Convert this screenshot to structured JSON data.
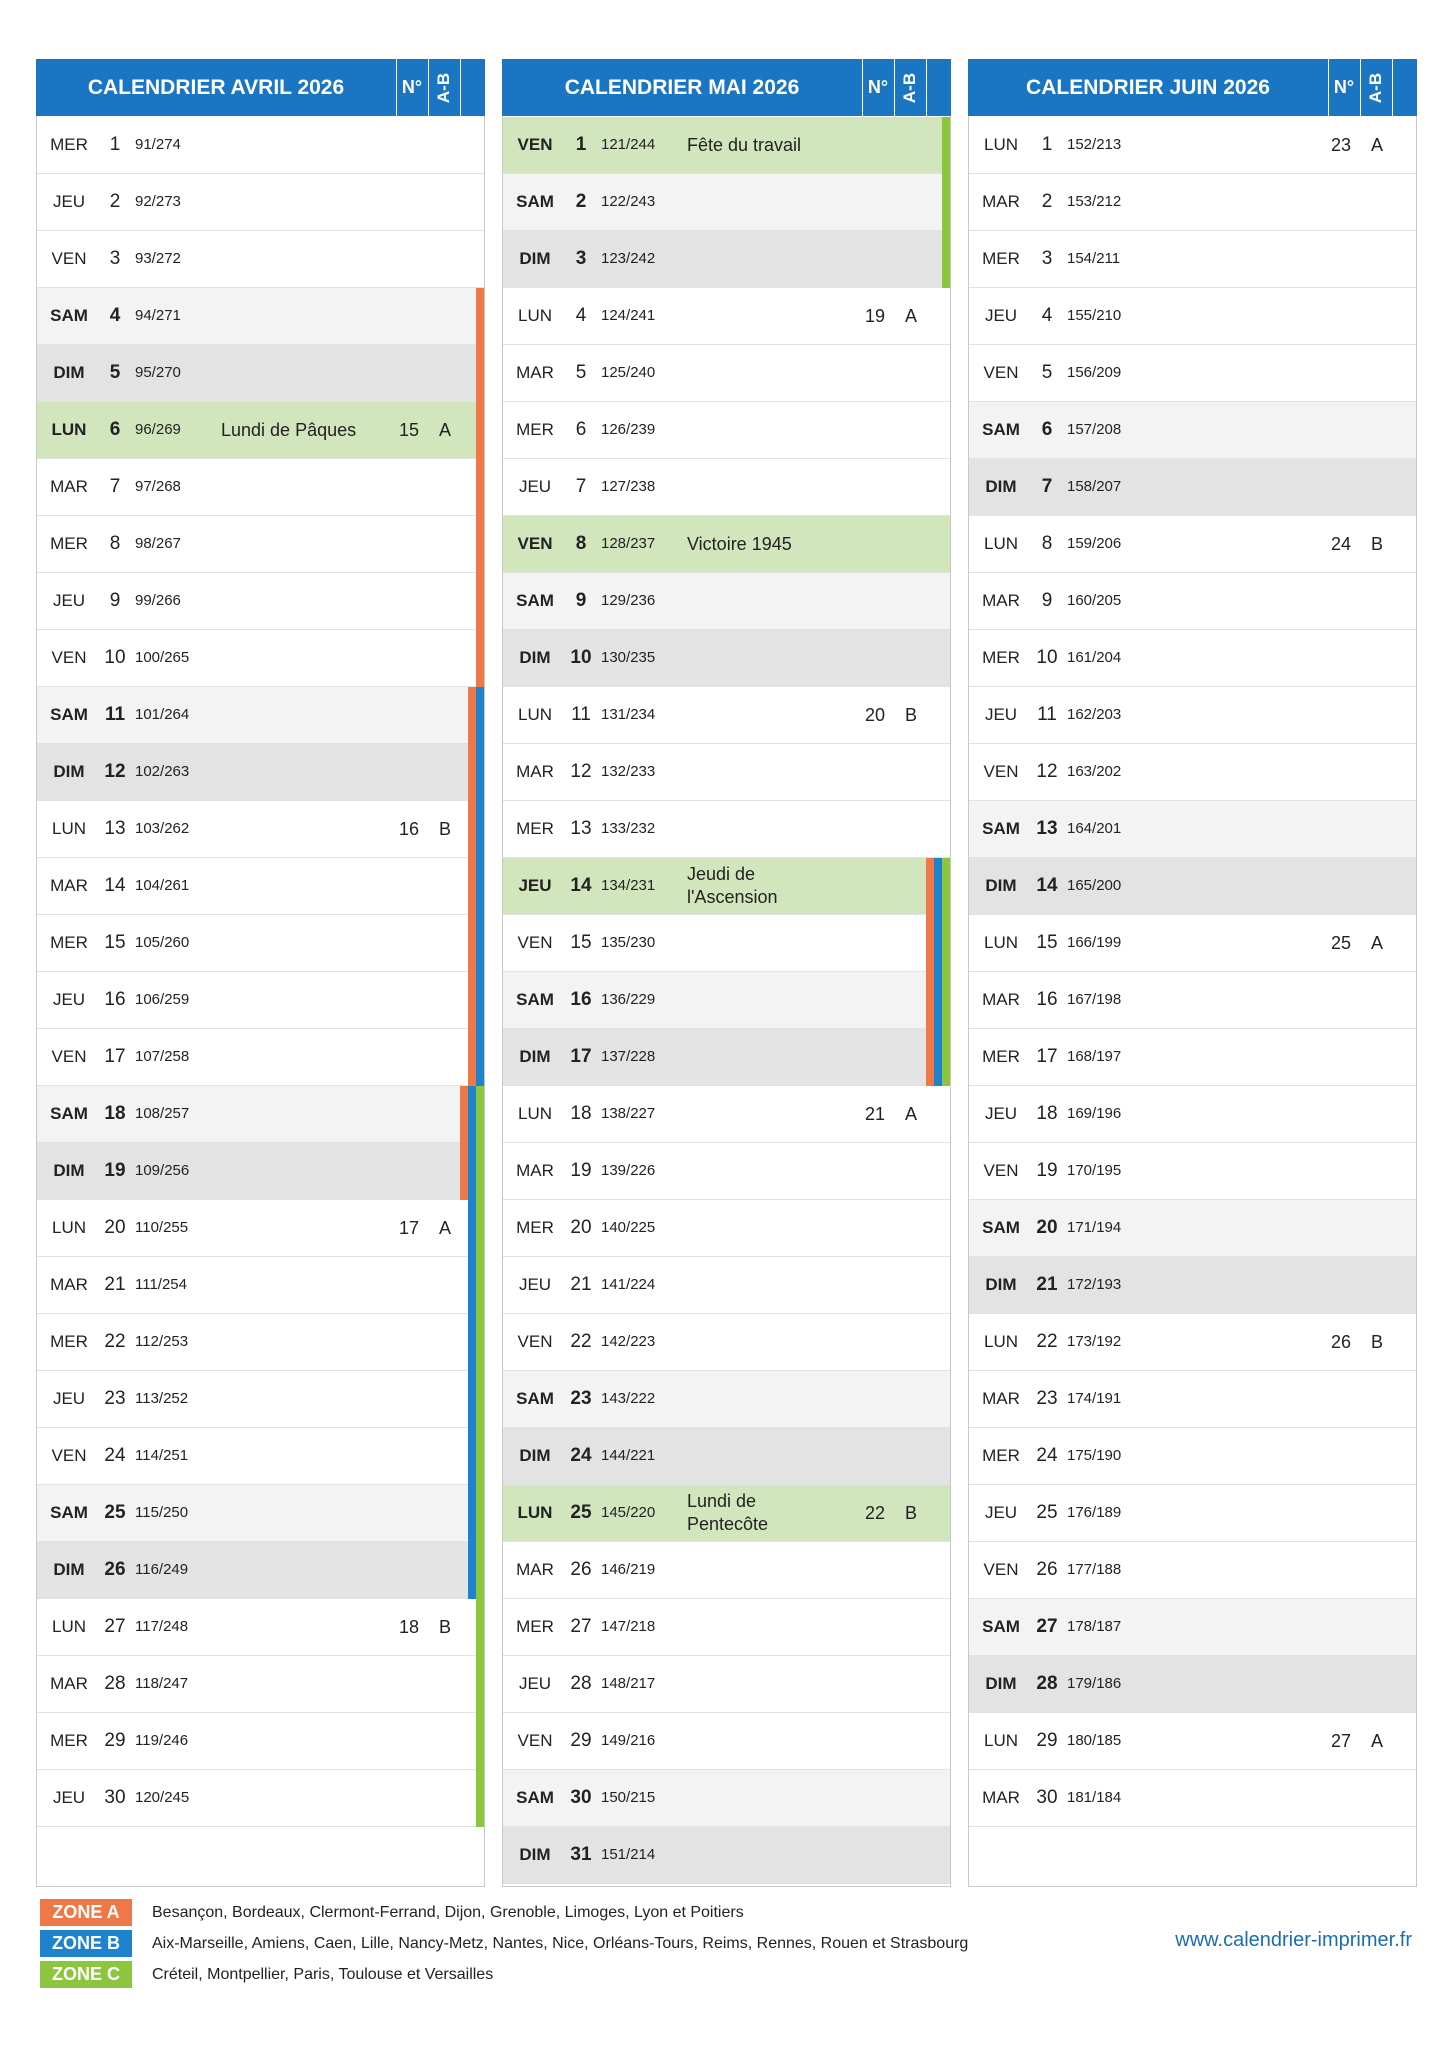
{
  "header_labels": {
    "no": "N°",
    "ab": "A-B"
  },
  "zones": [
    {
      "label": "ZONE A",
      "color": "#ee7848",
      "cities": "Besançon, Bordeaux, Clermont-Ferrand, Dijon, Grenoble, Limoges, Lyon et Poitiers"
    },
    {
      "label": "ZONE B",
      "color": "#1f82cc",
      "cities": "Aix-Marseille, Amiens, Caen, Lille, Nancy-Metz, Nantes, Nice, Orléans-Tours, Reims, Rennes, Rouen et Strasbourg"
    },
    {
      "label": "ZONE C",
      "color": "#8cc63e",
      "cities": "Créteil, Montpellier, Paris, Toulouse et Versailles"
    }
  ],
  "website": "www.calendrier-imprimer.fr",
  "months": [
    {
      "title": "CALENDRIER AVRIL 2026",
      "days": [
        {
          "d": "MER",
          "n": "1",
          "y": "91/274"
        },
        {
          "d": "JEU",
          "n": "2",
          "y": "92/273"
        },
        {
          "d": "VEN",
          "n": "3",
          "y": "93/272"
        },
        {
          "d": "SAM",
          "n": "4",
          "y": "94/271",
          "z": "A"
        },
        {
          "d": "DIM",
          "n": "5",
          "y": "95/270",
          "z": "A"
        },
        {
          "d": "LUN",
          "n": "6",
          "y": "96/269",
          "h": "Lundi de Pâques",
          "w": "15",
          "ab": "A",
          "z": "A"
        },
        {
          "d": "MAR",
          "n": "7",
          "y": "97/268",
          "z": "A"
        },
        {
          "d": "MER",
          "n": "8",
          "y": "98/267",
          "z": "A"
        },
        {
          "d": "JEU",
          "n": "9",
          "y": "99/266",
          "z": "A"
        },
        {
          "d": "VEN",
          "n": "10",
          "y": "100/265",
          "z": "A"
        },
        {
          "d": "SAM",
          "n": "11",
          "y": "101/264",
          "z": "AB"
        },
        {
          "d": "DIM",
          "n": "12",
          "y": "102/263",
          "z": "AB"
        },
        {
          "d": "LUN",
          "n": "13",
          "y": "103/262",
          "w": "16",
          "ab": "B",
          "z": "AB"
        },
        {
          "d": "MAR",
          "n": "14",
          "y": "104/261",
          "z": "AB"
        },
        {
          "d": "MER",
          "n": "15",
          "y": "105/260",
          "z": "AB"
        },
        {
          "d": "JEU",
          "n": "16",
          "y": "106/259",
          "z": "AB"
        },
        {
          "d": "VEN",
          "n": "17",
          "y": "107/258",
          "z": "AB"
        },
        {
          "d": "SAM",
          "n": "18",
          "y": "108/257",
          "z": "ABC"
        },
        {
          "d": "DIM",
          "n": "19",
          "y": "109/256",
          "z": "ABC"
        },
        {
          "d": "LUN",
          "n": "20",
          "y": "110/255",
          "w": "17",
          "ab": "A",
          "z": "BC"
        },
        {
          "d": "MAR",
          "n": "21",
          "y": "111/254",
          "z": "BC"
        },
        {
          "d": "MER",
          "n": "22",
          "y": "112/253",
          "z": "BC"
        },
        {
          "d": "JEU",
          "n": "23",
          "y": "113/252",
          "z": "BC"
        },
        {
          "d": "VEN",
          "n": "24",
          "y": "114/251",
          "z": "BC"
        },
        {
          "d": "SAM",
          "n": "25",
          "y": "115/250",
          "z": "BC"
        },
        {
          "d": "DIM",
          "n": "26",
          "y": "116/249",
          "z": "BC"
        },
        {
          "d": "LUN",
          "n": "27",
          "y": "117/248",
          "w": "18",
          "ab": "B",
          "z": "C"
        },
        {
          "d": "MAR",
          "n": "28",
          "y": "118/247",
          "z": "C"
        },
        {
          "d": "MER",
          "n": "29",
          "y": "119/246",
          "z": "C"
        },
        {
          "d": "JEU",
          "n": "30",
          "y": "120/245",
          "z": "C"
        }
      ]
    },
    {
      "title": "CALENDRIER MAI 2026",
      "days": [
        {
          "d": "VEN",
          "n": "1",
          "y": "121/244",
          "h": "Fête du travail",
          "z": "C"
        },
        {
          "d": "SAM",
          "n": "2",
          "y": "122/243",
          "z": "C"
        },
        {
          "d": "DIM",
          "n": "3",
          "y": "123/242",
          "z": "C"
        },
        {
          "d": "LUN",
          "n": "4",
          "y": "124/241",
          "w": "19",
          "ab": "A"
        },
        {
          "d": "MAR",
          "n": "5",
          "y": "125/240"
        },
        {
          "d": "MER",
          "n": "6",
          "y": "126/239"
        },
        {
          "d": "JEU",
          "n": "7",
          "y": "127/238"
        },
        {
          "d": "VEN",
          "n": "8",
          "y": "128/237",
          "h": "Victoire 1945"
        },
        {
          "d": "SAM",
          "n": "9",
          "y": "129/236"
        },
        {
          "d": "DIM",
          "n": "10",
          "y": "130/235"
        },
        {
          "d": "LUN",
          "n": "11",
          "y": "131/234",
          "w": "20",
          "ab": "B"
        },
        {
          "d": "MAR",
          "n": "12",
          "y": "132/233"
        },
        {
          "d": "MER",
          "n": "13",
          "y": "133/232"
        },
        {
          "d": "JEU",
          "n": "14",
          "y": "134/231",
          "h": "Jeudi de l'Ascension",
          "z": "ABC"
        },
        {
          "d": "VEN",
          "n": "15",
          "y": "135/230",
          "z": "ABC"
        },
        {
          "d": "SAM",
          "n": "16",
          "y": "136/229",
          "z": "ABC"
        },
        {
          "d": "DIM",
          "n": "17",
          "y": "137/228",
          "z": "ABC"
        },
        {
          "d": "LUN",
          "n": "18",
          "y": "138/227",
          "w": "21",
          "ab": "A"
        },
        {
          "d": "MAR",
          "n": "19",
          "y": "139/226"
        },
        {
          "d": "MER",
          "n": "20",
          "y": "140/225"
        },
        {
          "d": "JEU",
          "n": "21",
          "y": "141/224"
        },
        {
          "d": "VEN",
          "n": "22",
          "y": "142/223"
        },
        {
          "d": "SAM",
          "n": "23",
          "y": "143/222"
        },
        {
          "d": "DIM",
          "n": "24",
          "y": "144/221"
        },
        {
          "d": "LUN",
          "n": "25",
          "y": "145/220",
          "h": "Lundi de Pentecôte",
          "w": "22",
          "ab": "B"
        },
        {
          "d": "MAR",
          "n": "26",
          "y": "146/219"
        },
        {
          "d": "MER",
          "n": "27",
          "y": "147/218"
        },
        {
          "d": "JEU",
          "n": "28",
          "y": "148/217"
        },
        {
          "d": "VEN",
          "n": "29",
          "y": "149/216"
        },
        {
          "d": "SAM",
          "n": "30",
          "y": "150/215"
        },
        {
          "d": "DIM",
          "n": "31",
          "y": "151/214"
        }
      ]
    },
    {
      "title": "CALENDRIER JUIN 2026",
      "days": [
        {
          "d": "LUN",
          "n": "1",
          "y": "152/213",
          "w": "23",
          "ab": "A"
        },
        {
          "d": "MAR",
          "n": "2",
          "y": "153/212"
        },
        {
          "d": "MER",
          "n": "3",
          "y": "154/211"
        },
        {
          "d": "JEU",
          "n": "4",
          "y": "155/210"
        },
        {
          "d": "VEN",
          "n": "5",
          "y": "156/209"
        },
        {
          "d": "SAM",
          "n": "6",
          "y": "157/208"
        },
        {
          "d": "DIM",
          "n": "7",
          "y": "158/207"
        },
        {
          "d": "LUN",
          "n": "8",
          "y": "159/206",
          "w": "24",
          "ab": "B"
        },
        {
          "d": "MAR",
          "n": "9",
          "y": "160/205"
        },
        {
          "d": "MER",
          "n": "10",
          "y": "161/204"
        },
        {
          "d": "JEU",
          "n": "11",
          "y": "162/203"
        },
        {
          "d": "VEN",
          "n": "12",
          "y": "163/202"
        },
        {
          "d": "SAM",
          "n": "13",
          "y": "164/201"
        },
        {
          "d": "DIM",
          "n": "14",
          "y": "165/200"
        },
        {
          "d": "LUN",
          "n": "15",
          "y": "166/199",
          "w": "25",
          "ab": "A"
        },
        {
          "d": "MAR",
          "n": "16",
          "y": "167/198"
        },
        {
          "d": "MER",
          "n": "17",
          "y": "168/197"
        },
        {
          "d": "JEU",
          "n": "18",
          "y": "169/196"
        },
        {
          "d": "VEN",
          "n": "19",
          "y": "170/195"
        },
        {
          "d": "SAM",
          "n": "20",
          "y": "171/194"
        },
        {
          "d": "DIM",
          "n": "21",
          "y": "172/193"
        },
        {
          "d": "LUN",
          "n": "22",
          "y": "173/192",
          "w": "26",
          "ab": "B"
        },
        {
          "d": "MAR",
          "n": "23",
          "y": "174/191"
        },
        {
          "d": "MER",
          "n": "24",
          "y": "175/190"
        },
        {
          "d": "JEU",
          "n": "25",
          "y": "176/189"
        },
        {
          "d": "VEN",
          "n": "26",
          "y": "177/188"
        },
        {
          "d": "SAM",
          "n": "27",
          "y": "178/187"
        },
        {
          "d": "DIM",
          "n": "28",
          "y": "179/186"
        },
        {
          "d": "LUN",
          "n": "29",
          "y": "180/185",
          "w": "27",
          "ab": "A"
        },
        {
          "d": "MAR",
          "n": "30",
          "y": "181/184"
        }
      ]
    }
  ]
}
